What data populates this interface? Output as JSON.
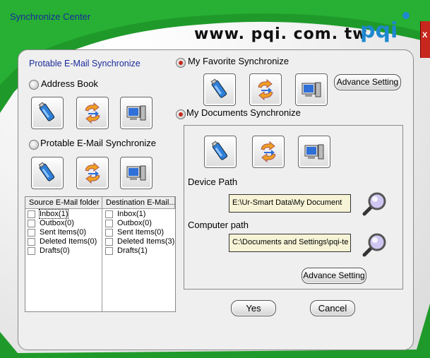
{
  "window": {
    "title": "Synchronize  Center",
    "website": "www. pqi. com. tw",
    "logo": "pqi",
    "close_label": "X"
  },
  "left": {
    "heading": "Protable E-Mail Synchronize",
    "address_book": {
      "label": "Address Book",
      "selected": false
    },
    "email_sync": {
      "label": "Protable E-Mail Synchronize",
      "selected": false
    },
    "grid": {
      "source_header": "Source E-Mail folder",
      "dest_header": "Destination E-Mail...",
      "source_items": [
        "Inbox(1)",
        "Outbox(0)",
        "Sent Items(0)",
        "Deleted Items(0)",
        "Drafts(0)"
      ],
      "dest_items": [
        "Inbox(1)",
        "Outbox(0)",
        "Sent Items(0)",
        "Deleted Items(3)",
        "Drafts(1)"
      ]
    }
  },
  "right": {
    "favorite": {
      "label": "My Favorite Synchronize",
      "selected": true,
      "advance_label": "Advance Setting"
    },
    "documents": {
      "label": "My Documents Synchronize",
      "selected": true,
      "device_path_label": "Device Path",
      "device_path_value": "E:\\Ur-Smart Data\\My Document",
      "computer_path_label": "Computer path",
      "computer_path_value": "C:\\Documents and Settings\\pqi-te",
      "advance_label": "Advance Setting"
    }
  },
  "footer": {
    "yes_label": "Yes",
    "cancel_label": "Cancel"
  },
  "icons": [
    "usb-drive-icon",
    "sync-arrows-icon",
    "computer-icon",
    "magnifier-icon"
  ]
}
